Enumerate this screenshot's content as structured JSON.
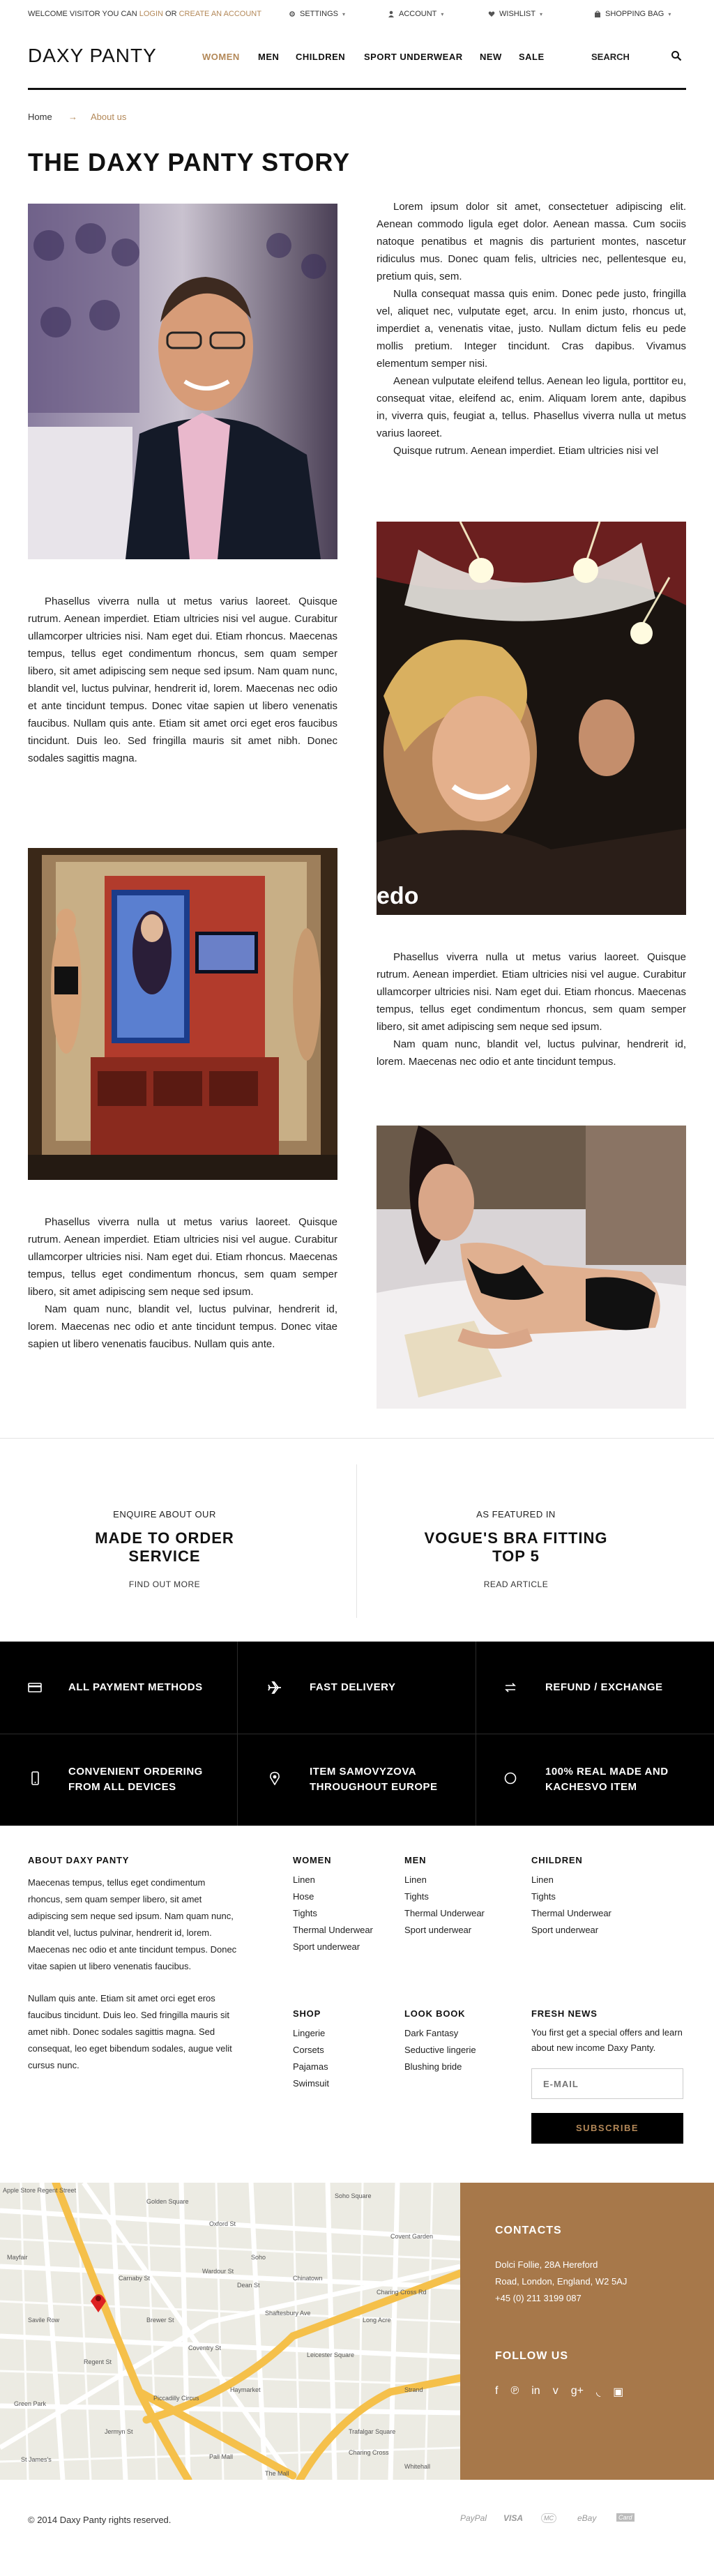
{
  "topbar": {
    "welcome_prefix": "WELCOME VISITOR YOU CAN ",
    "login": "LOGIN",
    "or": " OR ",
    "create": "CREATE AN ACCOUNT",
    "settings": "SETTINGS",
    "account": "ACCOUNT",
    "wishlist": "WISHLIST",
    "shopping_bag": "SHOPPING BAG"
  },
  "header": {
    "logo": "DAXY PANTY",
    "nav": [
      "WOMEN",
      "MEN",
      "CHILDREN",
      "SPORT UNDERWEAR",
      "NEW",
      "SALE"
    ],
    "search": "SEARCH"
  },
  "breadcrumb": {
    "home": "Home",
    "sep": "→",
    "current": "About us"
  },
  "page_title": "THE DAXY PANTY STORY",
  "story": {
    "p1a": "Lorem ipsum dolor sit amet, consectetuer adipiscing elit. Aenean commodo ligula eget dolor. Aenean massa. Cum sociis natoque penatibus et magnis dis parturient montes, nascetur ridiculus mus. Donec quam felis, ultricies nec, pellentesque eu, pretium quis, sem.",
    "p1b": "Nulla consequat massa quis enim. Donec pede justo, fringilla vel, aliquet nec, vulputate eget, arcu. In enim justo, rhoncus ut, imperdiet a, venenatis vitae, justo. Nullam dictum felis eu pede mollis pretium. Integer tincidunt. Cras dapibus. Vivamus elementum semper nisi.",
    "p1c": "Aenean vulputate eleifend tellus. Aenean leo ligula, porttitor eu, consequat vitae, eleifend ac, enim. Aliquam lorem ante, dapibus in, viverra quis, feugiat a, tellus. Phasellus viverra nulla ut metus varius laoreet.",
    "p1d": "Quisque rutrum. Aenean imperdiet. Etiam ultricies nisi vel",
    "p2": "Phasellus viverra nulla ut metus varius laoreet. Quisque rutrum. Aenean imperdiet. Etiam ultricies nisi vel augue. Curabitur ullamcorper ultricies nisi. Nam eget dui. Etiam rhoncus. Maecenas tempus, tellus eget condimentum rhoncus, sem quam semper libero, sit amet adipiscing sem neque sed ipsum. Nam quam nunc, blandit vel, luctus pulvinar, hendrerit id, lorem. Maecenas nec odio et ante tincidunt tempus. Donec vitae sapien ut libero venenatis faucibus. Nullam quis ante. Etiam sit amet orci eget eros faucibus tincidunt. Duis leo. Sed fringilla mauris sit amet nibh. Donec sodales sagittis magna.",
    "p3a": "Phasellus viverra nulla ut metus varius laoreet. Quisque rutrum. Aenean imperdiet. Etiam ultricies nisi vel augue. Curabitur ullamcorper ultricies nisi. Nam eget dui. Etiam rhoncus. Maecenas tempus, tellus eget condimentum rhoncus, sem quam semper libero, sit amet adipiscing sem neque sed ipsum.",
    "p3b": "Nam quam nunc, blandit vel, luctus pulvinar, hendrerit id, lorem. Maecenas nec odio et ante tincidunt tempus.",
    "p4a": "Phasellus viverra nulla ut metus varius laoreet. Quisque rutrum. Aenean imperdiet. Etiam ultricies nisi vel augue. Curabitur ullamcorper ultricies nisi. Nam eget dui. Etiam rhoncus. Maecenas tempus, tellus eget condimentum rhoncus, sem quam semper libero, sit amet adipiscing sem neque sed ipsum.",
    "p4b": "Nam quam nunc, blandit vel, luctus pulvinar, hendrerit id, lorem. Maecenas nec odio et ante tincidunt tempus. Donec vitae sapien ut libero venenatis faucibus. Nullam quis ante.",
    "photo_watermark": "edo"
  },
  "cards": [
    {
      "small": "ENQUIRE ABOUT OUR",
      "big": "MADE TO ORDER SERVICE",
      "link": "FIND OUT MORE"
    },
    {
      "small": "AS FEATURED IN",
      "big": "VOGUE'S BRA FITTING TOP 5",
      "link": "READ ARTICLE"
    }
  ],
  "features": [
    {
      "icon": "credit-card-icon",
      "line1": "ALL PAYMENT METHODS",
      "line2": ""
    },
    {
      "icon": "airplane-icon",
      "line1": "FAST DELIVERY",
      "line2": ""
    },
    {
      "icon": "exchange-icon",
      "line1": "REFUND / EXCHANGE",
      "line2": ""
    },
    {
      "icon": "mobile-icon",
      "line1": "CONVENIENT ORDERING",
      "line2": "FROM ALL DEVICES"
    },
    {
      "icon": "map-pin-icon",
      "line1": "ITEM SAMOVYZOVA",
      "line2": "THROUGHOUT EUROPE"
    },
    {
      "icon": "circle-check-icon",
      "line1": "100% REAL MADE AND",
      "line2": "KACHESVO ITEM"
    }
  ],
  "footer": {
    "about_title": "ABOUT DAXY PANTY",
    "about_p1": "Maecenas tempus, tellus eget condimentum rhoncus, sem quam semper libero, sit amet adipiscing sem neque sed ipsum. Nam quam nunc, blandit vel, luctus pulvinar, hendrerit id, lorem. Maecenas nec odio et ante tincidunt tempus. Donec vitae sapien ut libero venenatis faucibus.",
    "about_p2": "Nullam quis ante. Etiam sit amet orci eget eros faucibus tincidunt. Duis leo. Sed fringilla mauris sit amet nibh. Donec sodales sagittis magna. Sed consequat, leo eget bibendum sodales, augue velit cursus nunc.",
    "women_title": "WOMEN",
    "women": [
      "Linen",
      "Hose",
      "Tights",
      "Thermal Underwear",
      "Sport underwear"
    ],
    "men_title": "MEN",
    "men": [
      "Linen",
      "Tights",
      "Thermal Underwear",
      "Sport underwear"
    ],
    "children_title": "CHILDREN",
    "children": [
      "Linen",
      "Tights",
      "Thermal Underwear",
      "Sport underwear"
    ],
    "shop_title": "SHOP",
    "shop": [
      "Lingerie",
      "Corsets",
      "Pajamas",
      "Swimsuit"
    ],
    "lookbook_title": "LOOK BOOK",
    "lookbook": [
      "Dark Fantasy",
      "Seductive lingerie",
      "Blushing bride"
    ],
    "news_title": "FRESH NEWS",
    "news_text": "You first get a special offers and learn about new income Daxy Panty.",
    "email_placeholder": "E-MAIL",
    "subscribe": "SUBSCRIBE"
  },
  "map": {
    "streets": [
      "Apple Store Regent Street",
      "Golden Square",
      "Soho Square",
      "Oxford St",
      "Shaftesbury Ave",
      "Regent St",
      "Piccadilly Circus",
      "Leicester Square",
      "Trafalgar Square",
      "Pall Mall",
      "Haymarket",
      "Jermyn St",
      "Charing Cross Rd",
      "Coventry St",
      "St James's",
      "Whitehall",
      "The Mall",
      "Strand",
      "Covent Garden",
      "Soho",
      "Mayfair",
      "Charing Cross",
      "Chinatown",
      "Dean St",
      "Wardour St",
      "Carnaby St",
      "Brewer St",
      "Green Park",
      "Savile Row",
      "Long Acre"
    ]
  },
  "contacts": {
    "title": "CONTACTS",
    "address1": "Dolci Follie, 28A Hereford",
    "address2": "Road, London, England, W2 5AJ",
    "phone": "+45 (0) 211 3199 087",
    "follow": "FOLLOW US",
    "social": [
      "facebook-icon",
      "pinterest-icon",
      "linkedin-icon",
      "vimeo-icon",
      "google-plus-icon",
      "rss-icon",
      "instagram-icon"
    ]
  },
  "bottom": {
    "copyright": "© 2014 Daxy Panty rights reserved.",
    "payments": [
      "PayPal",
      "VISA",
      "MC",
      "eBay",
      "Card"
    ]
  },
  "colors": {
    "accent": "#b38858",
    "dark": "#000000",
    "contacts_bg": "#a7784a"
  }
}
